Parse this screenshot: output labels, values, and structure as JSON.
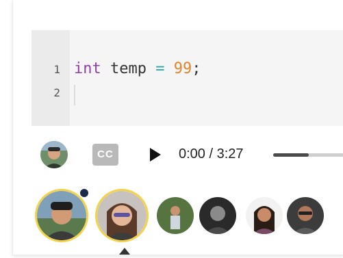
{
  "editor": {
    "line_numbers": [
      "1",
      "2"
    ],
    "code": {
      "keyword": "int",
      "identifier": "temp",
      "operator": "=",
      "number": "99",
      "punctuation": ";"
    },
    "colors": {
      "keyword": "#8f3fa6",
      "operator": "#2aa7a6",
      "number": "#e1862b"
    }
  },
  "player": {
    "cc_label": "CC",
    "time": "0:00 / 3:27",
    "progress_fraction": 0.0,
    "buffer_fraction": 0.5
  },
  "participants": {
    "count": 6,
    "highlight_color": "#f2d34a",
    "online_indicator_color": "#1c2b4a"
  }
}
